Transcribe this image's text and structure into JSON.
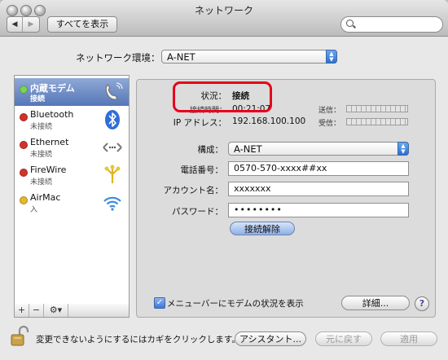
{
  "window": {
    "title": "ネットワーク"
  },
  "toolbar": {
    "back": "◀",
    "forward": "▶",
    "show_all": "すべてを表示",
    "search_placeholder": ""
  },
  "location": {
    "label": "ネットワーク環境：",
    "value": "A-NET"
  },
  "services": [
    {
      "name": "内蔵モデム",
      "status": "接続",
      "dot": "#7bd45a",
      "icon": "modem-icon",
      "selected": true
    },
    {
      "name": "Bluetooth",
      "status": "未接続",
      "dot": "#d3322b",
      "icon": "bluetooth-icon"
    },
    {
      "name": "Ethernet",
      "status": "未接続",
      "dot": "#d3322b",
      "icon": "ethernet-icon"
    },
    {
      "name": "FireWire",
      "status": "未接続",
      "dot": "#d3322b",
      "icon": "firewire-icon"
    },
    {
      "name": "AirMac",
      "status": "入",
      "dot": "#e7b72b",
      "icon": "airmac-icon"
    }
  ],
  "sidebar_tools": {
    "add": "+",
    "remove": "−",
    "action": "⚙▾"
  },
  "status": {
    "status_label": "状況：",
    "status_value": "接続",
    "time_label": "接続時間：",
    "time_value": "00:21:07",
    "ip_label": "IP アドレス：",
    "ip_value": "192.168.100.100",
    "send_label": "送信：",
    "recv_label": "受信："
  },
  "form": {
    "config_label": "構成：",
    "config_value": "A-NET",
    "phone_label": "電話番号：",
    "phone_value": "0570-570-xxxx##xx",
    "account_label": "アカウント名：",
    "account_value": "xxxxxxx",
    "password_label": "パスワード：",
    "password_value": "••••••••",
    "disconnect_button": "接続解除"
  },
  "menubar_option": {
    "label": "メニューバーにモデムの状況を表示",
    "checked": true
  },
  "advanced_button": "詳細...",
  "help": "?",
  "footer": {
    "lock_text": "変更できないようにするにはカギをクリックします。",
    "assistant": "アシスタント...",
    "revert": "元に戻す",
    "apply": "適用"
  },
  "colors": {
    "accent": "#3f78d3",
    "highlight": "#e8001c"
  }
}
